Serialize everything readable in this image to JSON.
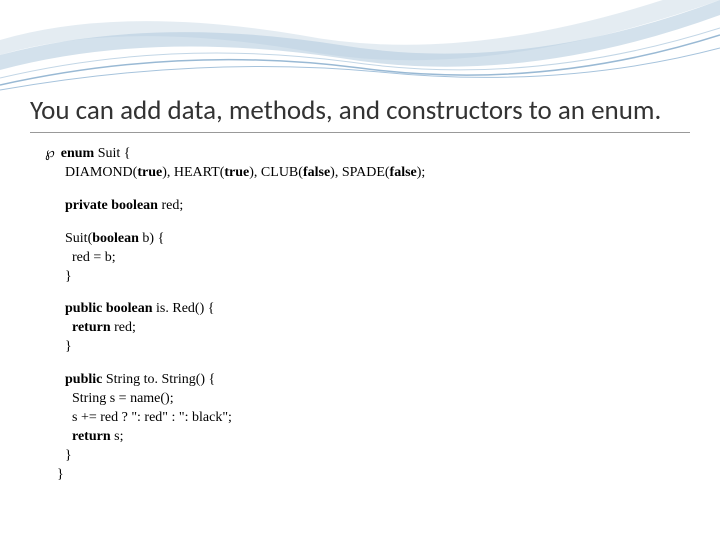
{
  "title": "You can add data, methods, and constructors to an enum.",
  "code": {
    "line1_kw": "enum",
    "line1_rest": " Suit {",
    "line2": "DIAMOND(",
    "line2_b1": "true",
    "line2_m1": "), HEART(",
    "line2_b2": "true",
    "line2_m2": "), CLUB(",
    "line2_b3": "false",
    "line2_m3": "), SPADE(",
    "line2_b4": "false",
    "line2_end": ");",
    "line3_kw": "private boolean",
    "line3_rest": " red;",
    "line4_a": "Suit(",
    "line4_b": "boolean",
    "line4_c": " b) {",
    "line5": "  red = b;",
    "line6": "}",
    "line7_kw": "public boolean",
    "line7_rest": " is. Red() {",
    "line8_kw": "return",
    "line8_rest": " red;",
    "line9": "}",
    "line10_kw": "public",
    "line10_rest": " String to. String() {",
    "line11": "  String s = name();",
    "line12a": "  s += red ? \": red\" : \": black\";",
    "line13_kw": "return",
    "line13_rest": " s;",
    "line14": "}",
    "line15": "}"
  }
}
